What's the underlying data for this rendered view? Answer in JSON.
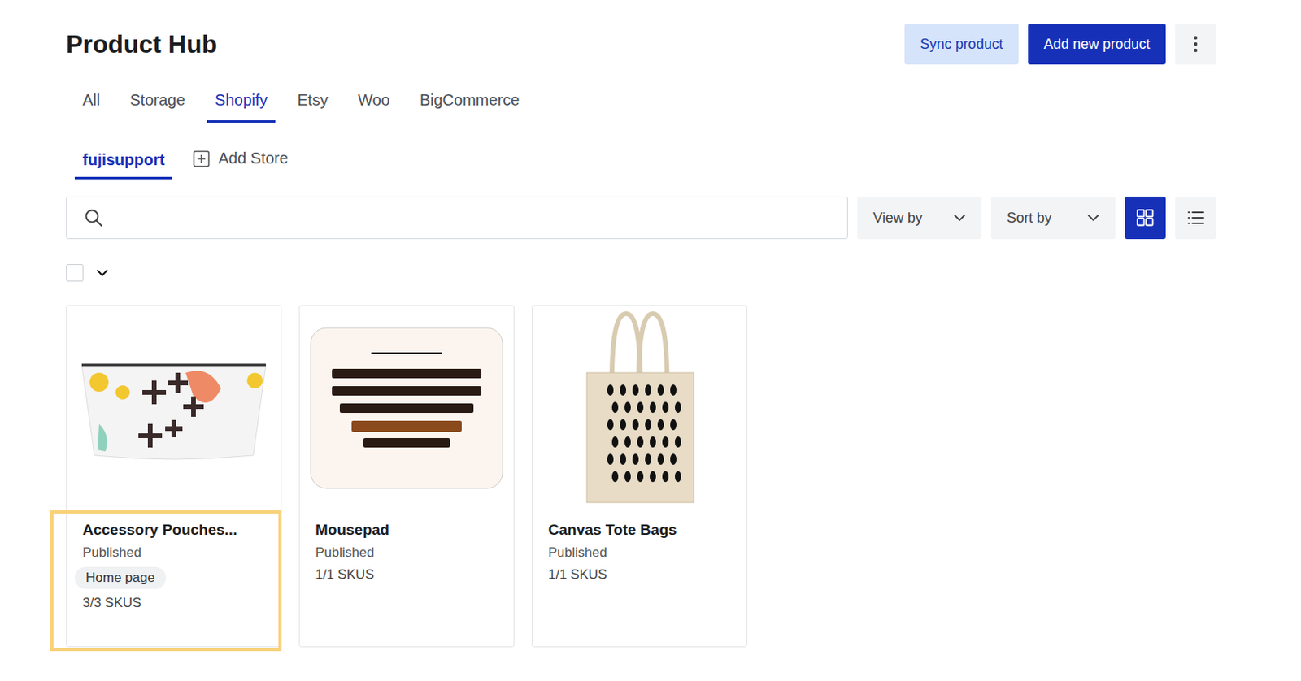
{
  "page": {
    "title": "Product Hub"
  },
  "actions": [
    {
      "label": "Sync product",
      "kind": "secondary"
    },
    {
      "label": "Add new product",
      "kind": "primary"
    }
  ],
  "tabs": [
    {
      "label": "All",
      "selected": false
    },
    {
      "label": "Storage",
      "selected": false
    },
    {
      "label": "Shopify",
      "selected": true
    },
    {
      "label": "Etsy",
      "selected": false
    },
    {
      "label": "Woo",
      "selected": false
    },
    {
      "label": "BigCommerce",
      "selected": false
    }
  ],
  "stores": [
    {
      "label": "fujisupport",
      "selected": true
    }
  ],
  "add_store": "Add Store",
  "search": {
    "placeholder": ""
  },
  "filters": [
    "View by",
    "Sort by"
  ],
  "view_modes": [
    {
      "kind": "grid",
      "selected": true
    },
    {
      "kind": "list",
      "selected": false
    }
  ],
  "select_all": {
    "checked": false
  },
  "products": [
    {
      "name": "Accessory Pouches...",
      "status": "Published",
      "tags": [
        "Home page"
      ],
      "skus": "3/3 SKUS",
      "kind": "pouch",
      "highlighted": true
    },
    {
      "name": "Mousepad",
      "status": "Published",
      "tags": [],
      "skus": "1/1 SKUS",
      "kind": "mousepad",
      "highlighted": false
    },
    {
      "name": "Canvas Tote Bags",
      "status": "Published",
      "tags": [],
      "skus": "1/1 SKUS",
      "kind": "tote",
      "highlighted": false
    }
  ]
}
